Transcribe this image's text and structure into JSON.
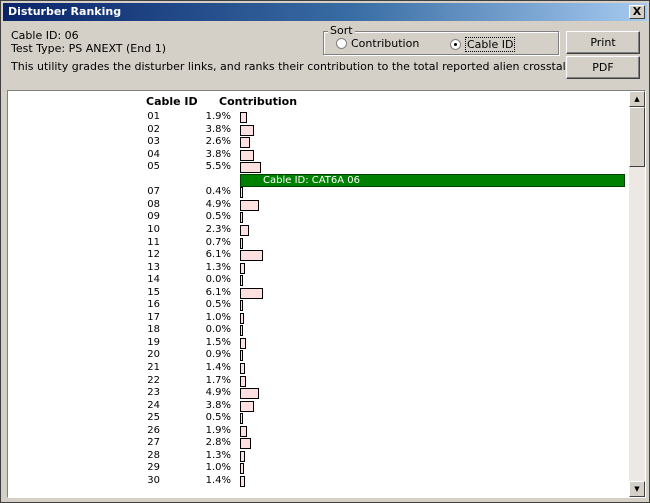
{
  "window": {
    "title": "Disturber Ranking",
    "close_label": "X"
  },
  "info": {
    "cable_id": "Cable ID: 06",
    "test_type": "Test Type: PS ANEXT (End 1)",
    "description": "This utility grades the disturber links, and ranks their contribution to the total reported alien crosstalk."
  },
  "sort": {
    "legend": "Sort",
    "options": [
      "Contribution",
      "Cable ID"
    ],
    "selected": "Cable ID"
  },
  "buttons": {
    "print": "Print",
    "pdf": "PDF"
  },
  "table": {
    "header_cable": "Cable ID",
    "header_contribution": "Contribution",
    "selected_label": "Cable ID: CAT6A 06",
    "rows": [
      {
        "id": "01",
        "pct": "1.9%",
        "v": 1.9
      },
      {
        "id": "02",
        "pct": "3.8%",
        "v": 3.8
      },
      {
        "id": "03",
        "pct": "2.6%",
        "v": 2.6
      },
      {
        "id": "04",
        "pct": "3.8%",
        "v": 3.8
      },
      {
        "id": "05",
        "pct": "5.5%",
        "v": 5.5
      },
      {
        "id": "",
        "pct": "",
        "v": 0,
        "selected": true
      },
      {
        "id": "07",
        "pct": "0.4%",
        "v": 0.4
      },
      {
        "id": "08",
        "pct": "4.9%",
        "v": 4.9
      },
      {
        "id": "09",
        "pct": "0.5%",
        "v": 0.5
      },
      {
        "id": "10",
        "pct": "2.3%",
        "v": 2.3
      },
      {
        "id": "11",
        "pct": "0.7%",
        "v": 0.7
      },
      {
        "id": "12",
        "pct": "6.1%",
        "v": 6.1
      },
      {
        "id": "13",
        "pct": "1.3%",
        "v": 1.3
      },
      {
        "id": "14",
        "pct": "0.0%",
        "v": 0.0
      },
      {
        "id": "15",
        "pct": "6.1%",
        "v": 6.1
      },
      {
        "id": "16",
        "pct": "0.5%",
        "v": 0.5
      },
      {
        "id": "17",
        "pct": "1.0%",
        "v": 1.0
      },
      {
        "id": "18",
        "pct": "0.0%",
        "v": 0.0
      },
      {
        "id": "19",
        "pct": "1.5%",
        "v": 1.5
      },
      {
        "id": "20",
        "pct": "0.9%",
        "v": 0.9
      },
      {
        "id": "21",
        "pct": "1.4%",
        "v": 1.4
      },
      {
        "id": "22",
        "pct": "1.7%",
        "v": 1.7
      },
      {
        "id": "23",
        "pct": "4.9%",
        "v": 4.9
      },
      {
        "id": "24",
        "pct": "3.8%",
        "v": 3.8
      },
      {
        "id": "25",
        "pct": "0.5%",
        "v": 0.5
      },
      {
        "id": "26",
        "pct": "1.9%",
        "v": 1.9
      },
      {
        "id": "27",
        "pct": "2.8%",
        "v": 2.8
      },
      {
        "id": "28",
        "pct": "1.3%",
        "v": 1.3
      },
      {
        "id": "29",
        "pct": "1.0%",
        "v": 1.0
      },
      {
        "id": "30",
        "pct": "1.4%",
        "v": 1.4
      }
    ]
  },
  "colors": {
    "bar_fill": "#ffe0e0",
    "selected_bar": "#008000"
  }
}
